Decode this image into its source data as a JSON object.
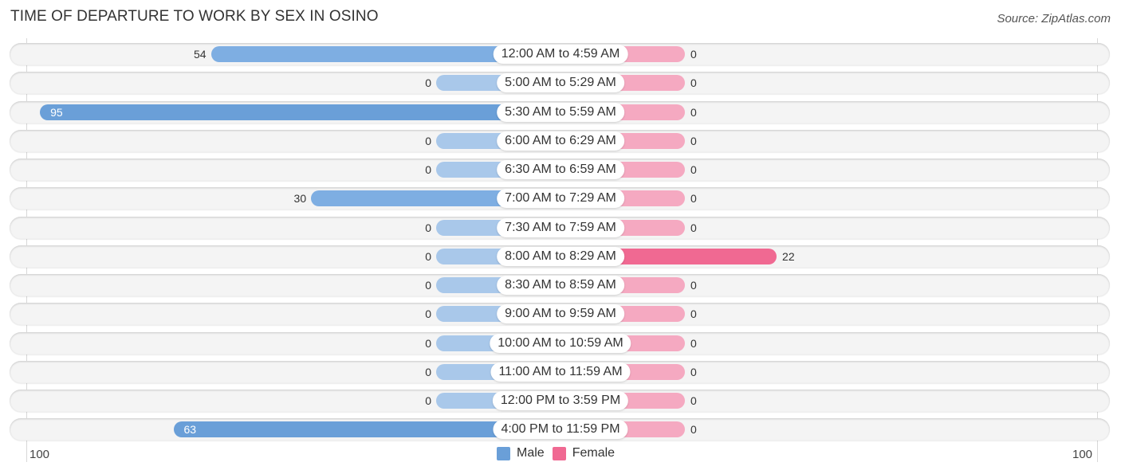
{
  "chart_data": {
    "type": "bar",
    "orientation": "horizontal-diverging",
    "title": "TIME OF DEPARTURE TO WORK BY SEX IN OSINO",
    "source": "Source: ZipAtlas.com",
    "categories": [
      "12:00 AM to 4:59 AM",
      "5:00 AM to 5:29 AM",
      "5:30 AM to 5:59 AM",
      "6:00 AM to 6:29 AM",
      "6:30 AM to 6:59 AM",
      "7:00 AM to 7:29 AM",
      "7:30 AM to 7:59 AM",
      "8:00 AM to 8:29 AM",
      "8:30 AM to 8:59 AM",
      "9:00 AM to 9:59 AM",
      "10:00 AM to 10:59 AM",
      "11:00 AM to 11:59 AM",
      "12:00 PM to 3:59 PM",
      "4:00 PM to 11:59 PM"
    ],
    "series": [
      {
        "name": "Male",
        "color": "#6a9fd8",
        "light_color": "#a9c8ea",
        "values": [
          54,
          0,
          95,
          0,
          0,
          30,
          0,
          0,
          0,
          0,
          0,
          0,
          0,
          63
        ]
      },
      {
        "name": "Female",
        "color": "#f06992",
        "light_color": "#f5a9c1",
        "values": [
          0,
          0,
          0,
          0,
          0,
          0,
          0,
          22,
          0,
          0,
          0,
          0,
          0,
          0
        ]
      }
    ],
    "xlim": [
      -100,
      100
    ],
    "axis_labels": {
      "left": "100",
      "right": "100"
    },
    "legend": {
      "position": "bottom-center",
      "entries": [
        "Male",
        "Female"
      ]
    },
    "grid": false
  }
}
